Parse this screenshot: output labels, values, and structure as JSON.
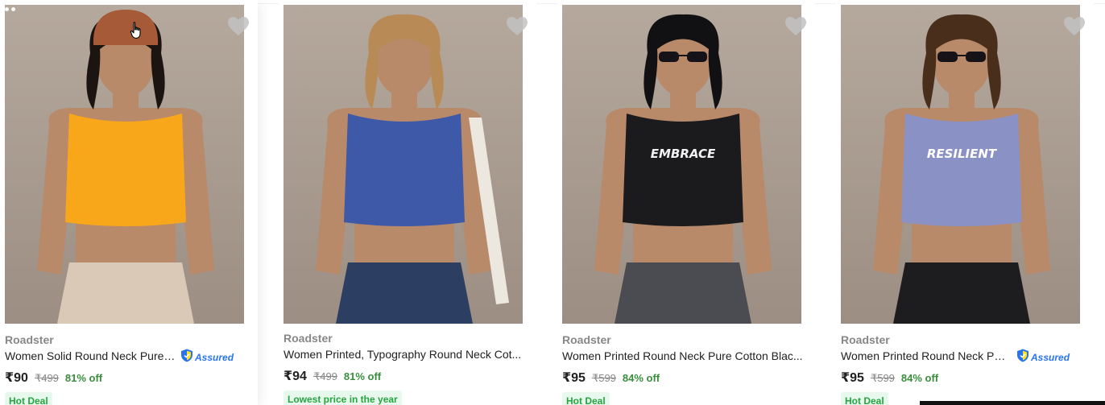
{
  "theme": {
    "accent": "#2874f0",
    "discount_green": "#388e3c",
    "tag_green": "#26a541",
    "tag_bg": "#e7f8ec",
    "photo_bg": "#a8998d",
    "wishlist_heart": "#c2c2c2"
  },
  "assured_label": "Assured",
  "products": [
    {
      "brand": "Roadster",
      "title": "Women Solid Round Neck Pure ...",
      "assured": true,
      "price": "₹90",
      "mrp": "₹499",
      "discount": "81% off",
      "tag": "Hot Deal",
      "top_color": "#f8a71b",
      "top_print": "",
      "bottom_color": "#d9c9b6",
      "hair_color": "#1c1410",
      "accessory": "beanie",
      "image_dots": true
    },
    {
      "brand": "Roadster",
      "title": "Women Printed, Typography Round Neck Cot...",
      "assured": false,
      "price": "₹94",
      "mrp": "₹499",
      "discount": "81% off",
      "tag": "Lowest price in the year",
      "top_color": "#3d59a8",
      "top_print": "",
      "bottom_color": "#2d3e63",
      "hair_color": "#b88a55",
      "accessory": "bag-strap",
      "image_dots": false
    },
    {
      "brand": "Roadster",
      "title": "Women Printed Round Neck Pure Cotton Blac...",
      "assured": false,
      "price": "₹95",
      "mrp": "₹599",
      "discount": "84% off",
      "tag": "Hot Deal",
      "top_color": "#1b1b1e",
      "top_print": "EMBRACE",
      "bottom_color": "#4a4c52",
      "hair_color": "#111012",
      "accessory": "sunglasses",
      "image_dots": false
    },
    {
      "brand": "Roadster",
      "title": "Women Printed Round Neck Pur...",
      "assured": true,
      "price": "₹95",
      "mrp": "₹599",
      "discount": "84% off",
      "tag": "Hot Deal",
      "top_color": "#8a91c4",
      "top_print": "RESILIENT",
      "bottom_color": "#1d1d20",
      "hair_color": "#4a2e1c",
      "accessory": "sunglasses",
      "image_dots": false
    }
  ]
}
